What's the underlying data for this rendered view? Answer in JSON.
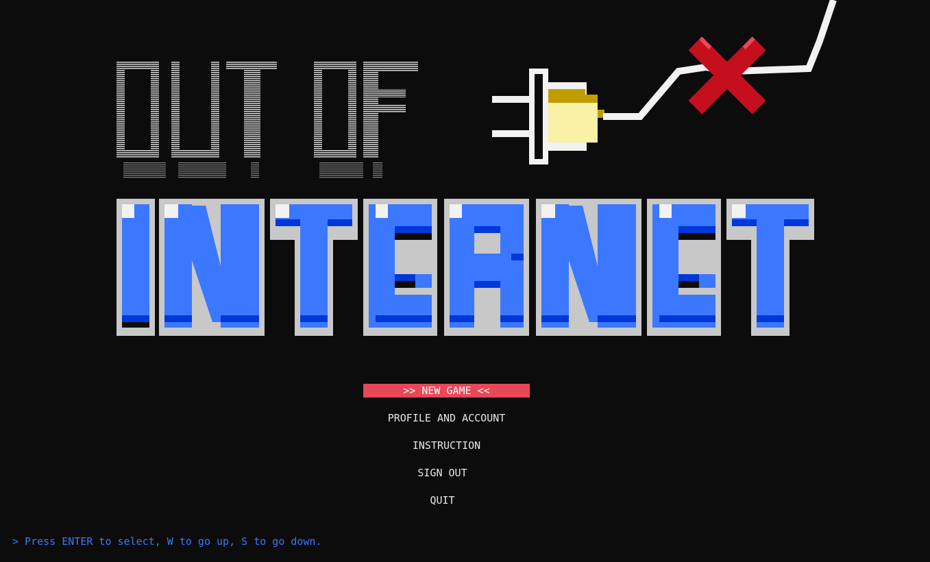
{
  "title": {
    "line1": "OUT OF",
    "line2": "INTERNET",
    "logo_colors": {
      "outline_light_gray": "#c8c8c8",
      "letter_blue": "#3b78ff",
      "letter_shadow_blue": "#0037da",
      "highlight_white": "#f2f2f2",
      "plug_yellow": "#f9f1a5",
      "plug_gold": "#c19c00",
      "cross_red": "#c50f1f",
      "cross_light_red": "#e74856",
      "cable_white": "#f2f2f2"
    },
    "icons": [
      "unplugged-plug-icon",
      "red-cross-icon"
    ]
  },
  "menu": {
    "items": [
      {
        "label": ">> NEW GAME <<",
        "selected": true
      },
      {
        "label": "PROFILE AND ACCOUNT",
        "selected": false
      },
      {
        "label": "INSTRUCTION",
        "selected": false
      },
      {
        "label": "SIGN OUT",
        "selected": false
      },
      {
        "label": "QUIT",
        "selected": false
      }
    ],
    "selected_color": "#e8475a",
    "text_color": "#e6e6e6"
  },
  "hint": {
    "text": "> Press ENTER to select, W to go up, S to go down.",
    "color": "#3b78ff"
  },
  "background_color": "#0c0c0c"
}
